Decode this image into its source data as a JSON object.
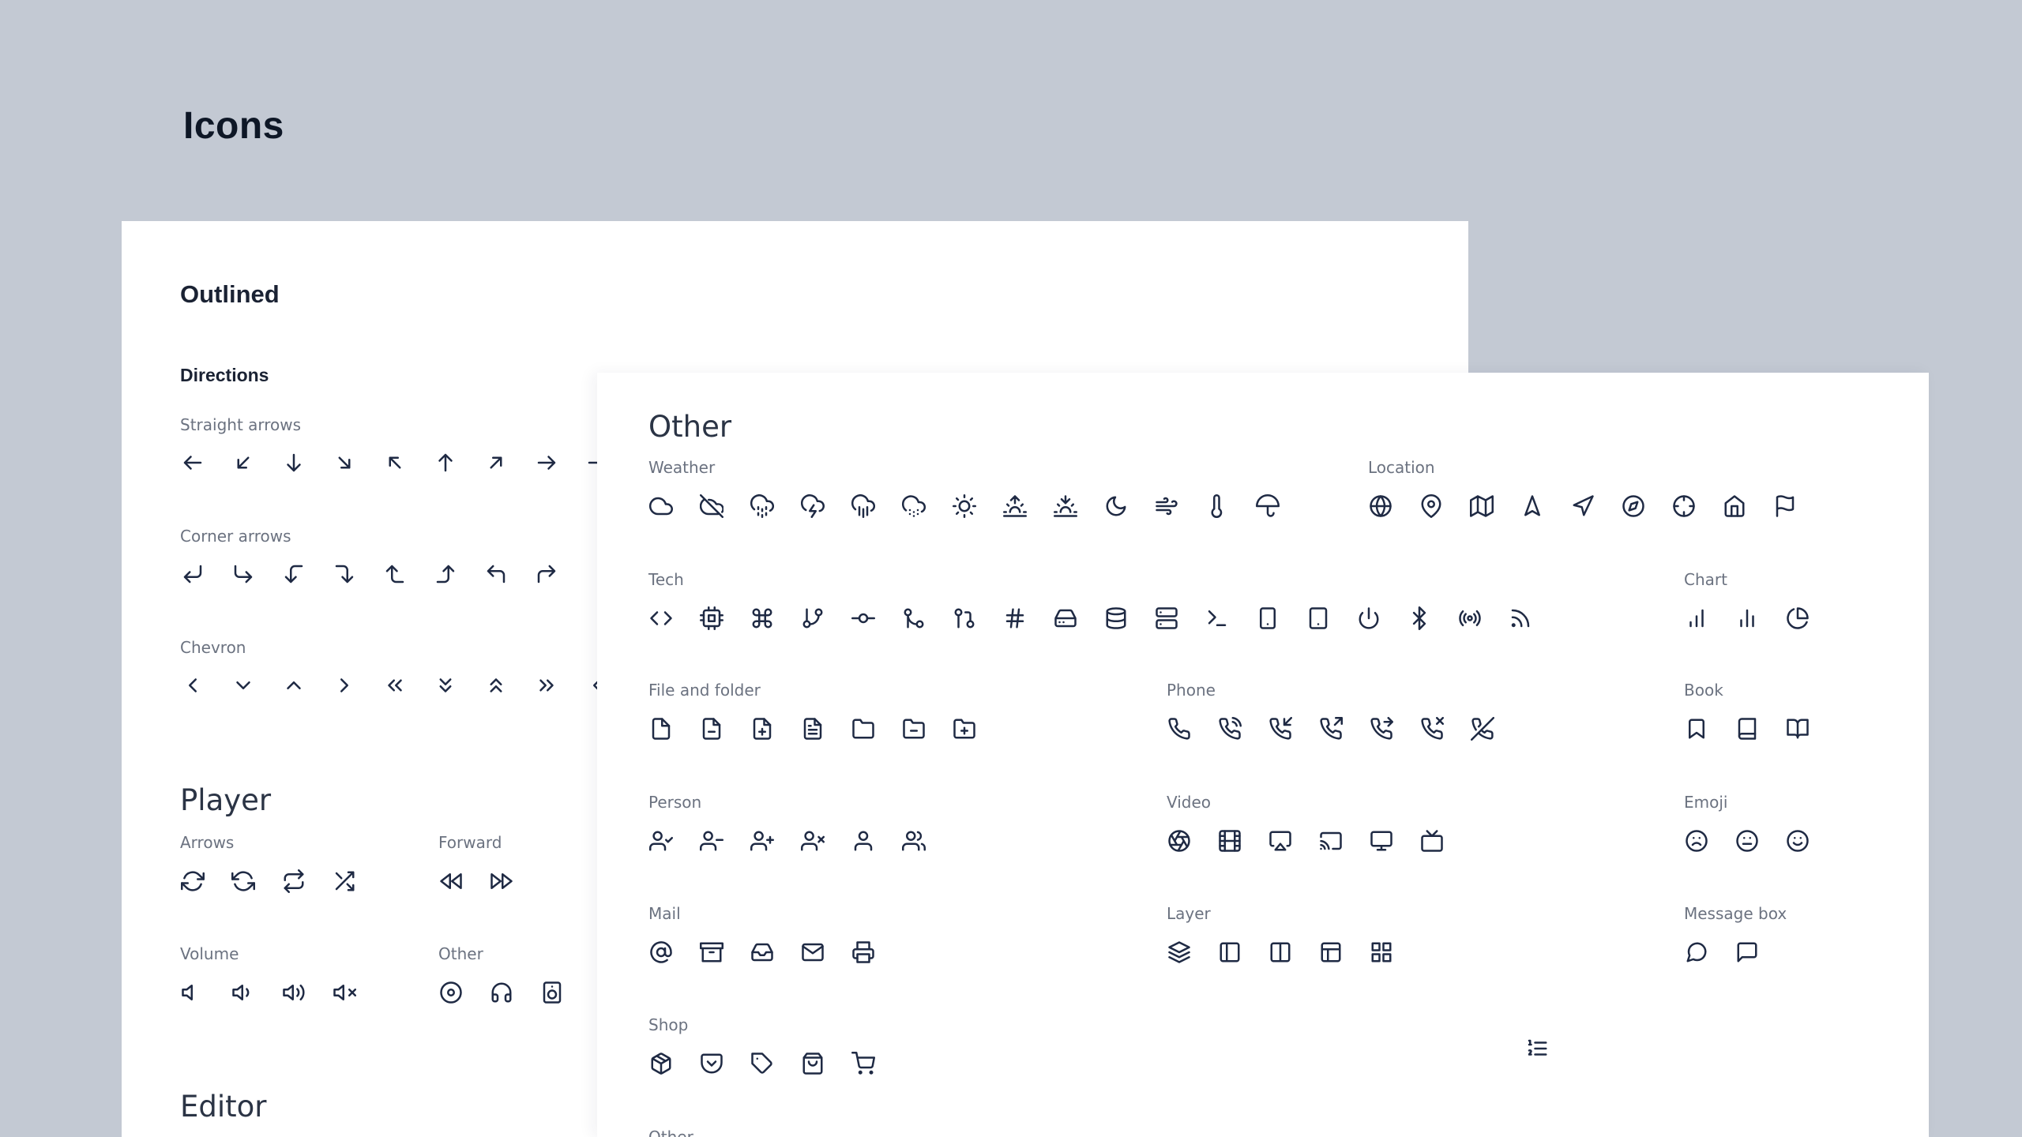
{
  "page": {
    "title": "Icons"
  },
  "outlined_card": {
    "heading": "Outlined",
    "directions": {
      "title": "Directions",
      "groups": [
        {
          "label": "Straight arrows",
          "icons": [
            "arrow-left",
            "arrow-down-left",
            "arrow-down",
            "arrow-down-right",
            "arrow-up-left",
            "arrow-up",
            "arrow-up-right",
            "arrow-right",
            "arrow-right-partial"
          ]
        },
        {
          "label": "Corner arrows",
          "icons": [
            "corner-down-left",
            "corner-down-right",
            "corner-left-down",
            "corner-right-down",
            "corner-left-up",
            "corner-right-up",
            "corner-up-left",
            "corner-up-right"
          ]
        },
        {
          "label": "Chevron",
          "icons": [
            "chevron-left",
            "chevron-down",
            "chevron-up",
            "chevron-right",
            "chevrons-left",
            "chevrons-down",
            "chevrons-up",
            "chevrons-right",
            "chevron-left-partial"
          ]
        }
      ]
    },
    "player": {
      "title": "Player",
      "groups": [
        {
          "label": "Arrows",
          "icons": [
            "refresh",
            "rotate",
            "repeat",
            "shuffle"
          ]
        },
        {
          "label": "Forward",
          "icons": [
            "rewind",
            "fast-forward"
          ]
        },
        {
          "label": "Volume",
          "icons": [
            "volume-low",
            "volume",
            "volume-high",
            "volume-mute"
          ]
        },
        {
          "label": "Other",
          "icons": [
            "disc",
            "headphones",
            "speaker"
          ]
        }
      ]
    },
    "editor": {
      "title": "Editor"
    }
  },
  "other_card": {
    "heading": "Other",
    "groups": {
      "weather": {
        "label": "Weather",
        "icons": [
          "cloud",
          "cloud-off",
          "cloud-drizzle",
          "cloud-lightning",
          "cloud-rain",
          "cloud-snow",
          "sun",
          "sunrise",
          "sunset",
          "moon",
          "wind",
          "thermometer",
          "umbrella"
        ]
      },
      "location": {
        "label": "Location",
        "icons": [
          "globe",
          "map-pin",
          "map",
          "navigation",
          "navigation-2",
          "compass",
          "crosshair",
          "home",
          "flag"
        ]
      },
      "tech": {
        "label": "Tech",
        "icons": [
          "code",
          "cpu",
          "command",
          "git-branch",
          "git-commit",
          "git-merge",
          "git-pull-request",
          "hash",
          "hard-drive",
          "database",
          "server",
          "terminal",
          "smartphone",
          "tablet",
          "power",
          "bluetooth",
          "radio",
          "rss"
        ]
      },
      "chart": {
        "label": "Chart",
        "icons": [
          "bar-chart",
          "bar-chart-2",
          "pie-chart"
        ]
      },
      "file": {
        "label": "File and folder",
        "icons": [
          "file",
          "file-minus",
          "file-plus",
          "file-text",
          "folder",
          "folder-minus",
          "folder-plus"
        ]
      },
      "phone": {
        "label": "Phone",
        "icons": [
          "phone",
          "phone-call",
          "phone-incoming",
          "phone-outgoing",
          "phone-forwarded",
          "phone-missed",
          "phone-off"
        ]
      },
      "book": {
        "label": "Book",
        "icons": [
          "bookmark",
          "book",
          "book-open"
        ]
      },
      "person": {
        "label": "Person",
        "icons": [
          "user-check",
          "user-minus",
          "user-plus",
          "user-x",
          "user",
          "users"
        ]
      },
      "video": {
        "label": "Video",
        "icons": [
          "aperture",
          "film",
          "airplay",
          "cast",
          "monitor",
          "tv"
        ]
      },
      "emoji": {
        "label": "Emoji",
        "icons": [
          "frown",
          "meh",
          "smile"
        ]
      },
      "mail": {
        "label": "Mail",
        "icons": [
          "at-sign",
          "archive",
          "inbox",
          "mail",
          "printer"
        ]
      },
      "layer": {
        "label": "Layer",
        "icons": [
          "layers",
          "sidebar",
          "columns",
          "layout",
          "grid"
        ]
      },
      "message": {
        "label": "Message box",
        "icons": [
          "message-circle",
          "message-square"
        ]
      },
      "shop": {
        "label": "Shop",
        "icons": [
          "package",
          "pocket",
          "tag",
          "shopping-bag",
          "shopping-cart"
        ]
      },
      "other": {
        "label": "Other",
        "icons": [
          "list-ordered"
        ]
      }
    }
  }
}
